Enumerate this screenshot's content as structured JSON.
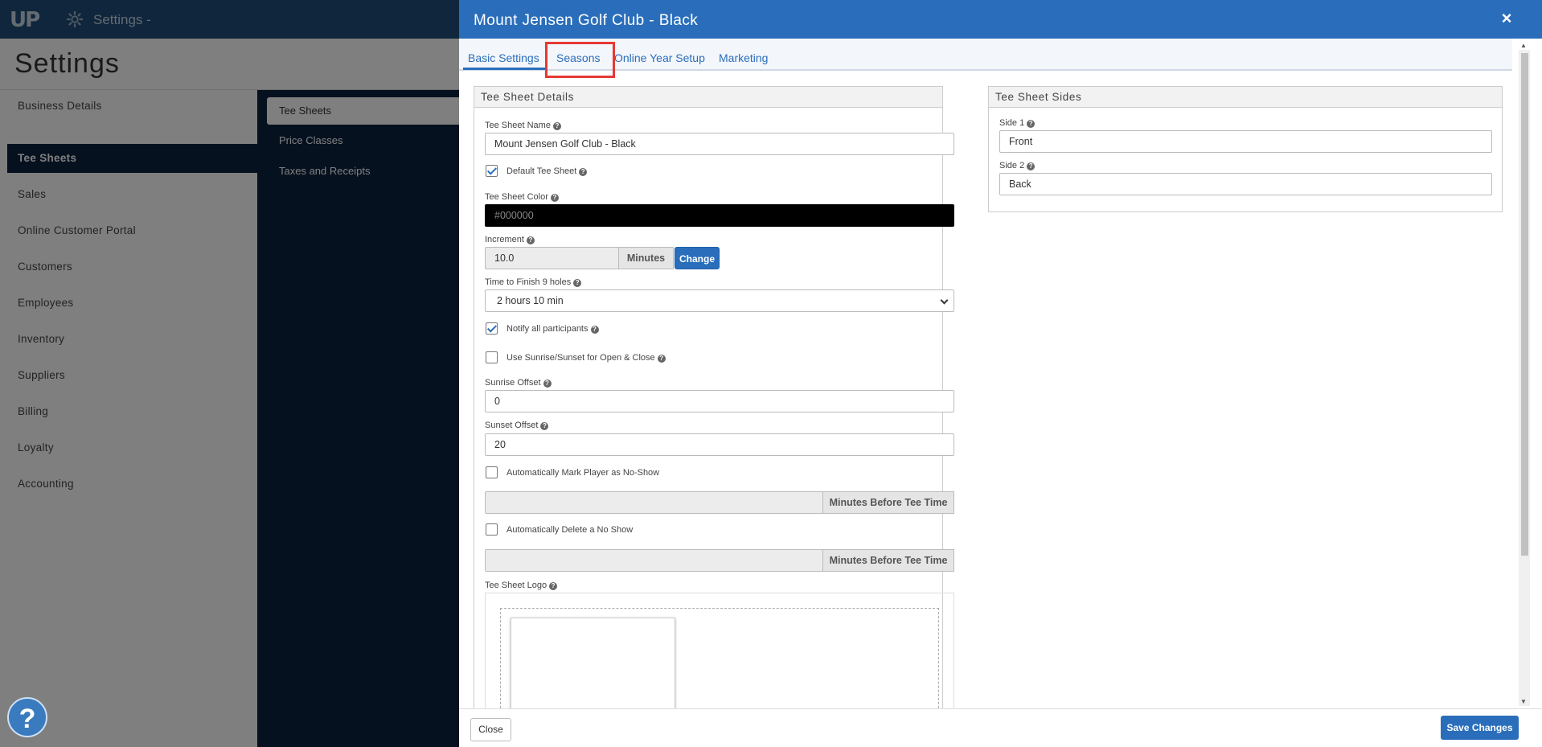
{
  "topbar": {
    "logo": "UP",
    "settings_menu": "Settings -"
  },
  "page": {
    "title": "Settings"
  },
  "leftnav": {
    "items": [
      {
        "label": "Business Details"
      },
      {
        "label": "Tee Sheets"
      },
      {
        "label": "Sales"
      },
      {
        "label": "Online Customer Portal"
      },
      {
        "label": "Customers"
      },
      {
        "label": "Employees"
      },
      {
        "label": "Inventory"
      },
      {
        "label": "Suppliers"
      },
      {
        "label": "Billing"
      },
      {
        "label": "Loyalty"
      },
      {
        "label": "Accounting"
      }
    ]
  },
  "subnav": {
    "items": [
      {
        "label": "Tee Sheets"
      },
      {
        "label": "Price Classes"
      },
      {
        "label": "Taxes and Receipts"
      }
    ]
  },
  "modal": {
    "title": "Mount Jensen Golf Club - Black",
    "close": "×",
    "tabs": [
      {
        "label": "Basic Settings"
      },
      {
        "label": "Seasons"
      },
      {
        "label": "Online Year Setup"
      },
      {
        "label": "Marketing"
      }
    ],
    "details": {
      "heading": "Tee Sheet Details",
      "name_label": "Tee Sheet Name",
      "name_value": "Mount Jensen Golf Club - Black",
      "default_label": "Default Tee Sheet",
      "color_label": "Tee Sheet Color",
      "color_value": "#000000",
      "increment_label": "Increment",
      "increment_value": "10.0",
      "increment_unit": "Minutes",
      "change_button": "Change",
      "finish_label": "Time to Finish 9 holes",
      "finish_value": "2 hours 10 min",
      "notify_label": "Notify all participants",
      "sunrise_sunset_label": "Use Sunrise/Sunset for Open & Close",
      "sunrise_label": "Sunrise Offset",
      "sunrise_value": "0",
      "sunset_label": "Sunset Offset",
      "sunset_value": "20",
      "noshow_label": "Automatically Mark Player as No-Show",
      "noshow_unit": "Minutes Before Tee Time",
      "delete_label": "Automatically Delete a No Show",
      "delete_unit": "Minutes Before Tee Time",
      "logo_label": "Tee Sheet Logo"
    },
    "sides": {
      "heading": "Tee Sheet Sides",
      "side1_label": "Side 1",
      "side1_value": "Front",
      "side2_label": "Side 2",
      "side2_value": "Back"
    },
    "footer": {
      "close": "Close",
      "save": "Save Changes"
    }
  },
  "help": "?",
  "colors": {
    "primary": "#2a6ebb",
    "nav_dark": "#0c2340",
    "highlight": "#e53935"
  }
}
